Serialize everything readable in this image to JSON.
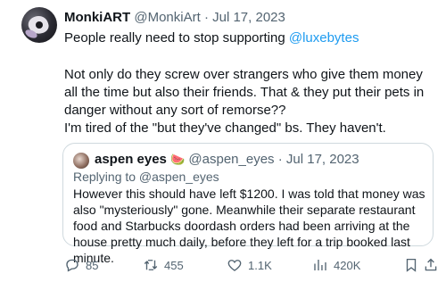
{
  "tweet": {
    "author_name": "MonkiART",
    "author_handle": "@MonkiArt",
    "separator": "·",
    "date": "Jul 17, 2023",
    "line1_prefix": "People really need to stop supporting ",
    "line1_mention": "@luxebytes",
    "paragraph2": "Not only do they screw over strangers who give them money all the time but also their friends. That & they put their pets in danger without any sort of remorse??",
    "paragraph3": "I'm tired of the \"but they've changed\" bs. They haven't."
  },
  "quote": {
    "author_name": "aspen eyes",
    "emoji": "🍉",
    "author_handle": "@aspen_eyes",
    "separator": "·",
    "date": "Jul 17, 2023",
    "replying_to": "Replying to @aspen_eyes",
    "text": "However this should have left $1200. I was told that money was also \"mysteriously\" gone. Meanwhile their separate restaurant food and Starbucks doordash orders had been arriving at the house pretty much daily, before they left for a trip booked last minute."
  },
  "actions": {
    "replies": "85",
    "reposts": "455",
    "likes": "1.1K",
    "views": "420K"
  },
  "icons": {
    "reply": "reply-icon",
    "repost": "repost-icon",
    "like": "heart-icon",
    "views": "views-icon",
    "bookmark": "bookmark-icon",
    "share": "share-icon"
  },
  "colors": {
    "link": "#1d9bf0",
    "secondary_text": "#536471",
    "border": "#cfd9de"
  }
}
